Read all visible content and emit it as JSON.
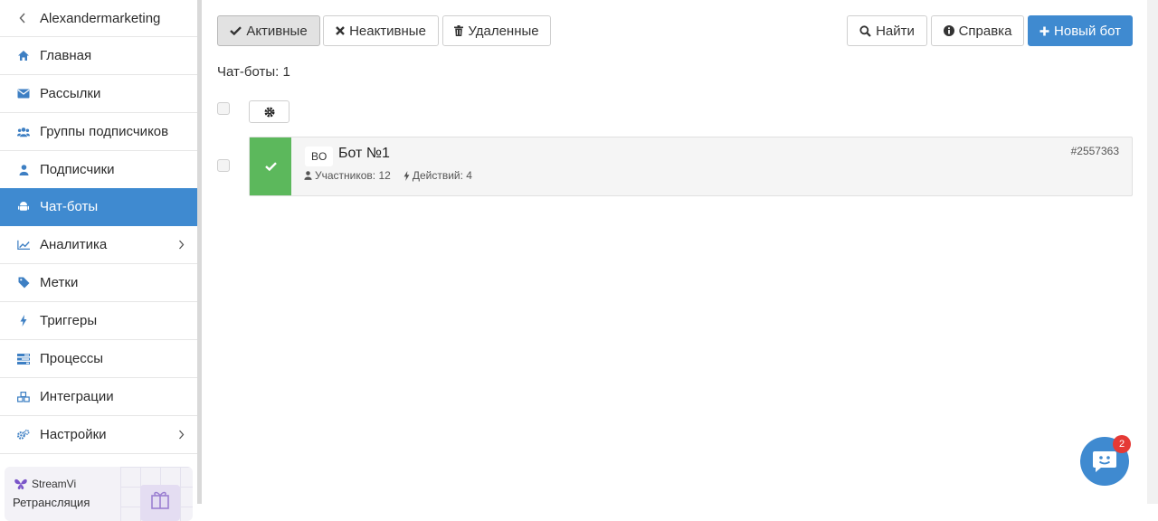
{
  "sidebar": {
    "account_name": "Alexandermarketing",
    "items": [
      {
        "label": "Главная",
        "icon": "home-icon"
      },
      {
        "label": "Рассылки",
        "icon": "envelope-icon"
      },
      {
        "label": "Группы подписчиков",
        "icon": "users-icon"
      },
      {
        "label": "Подписчики",
        "icon": "user-icon"
      },
      {
        "label": "Чат-боты",
        "icon": "android-icon",
        "active": true
      },
      {
        "label": "Аналитика",
        "icon": "chart-line-icon",
        "has_submenu": true
      },
      {
        "label": "Метки",
        "icon": "tag-icon"
      },
      {
        "label": "Триггеры",
        "icon": "bolt-icon"
      },
      {
        "label": "Процессы",
        "icon": "tasks-icon"
      },
      {
        "label": "Интеграции",
        "icon": "cubes-icon"
      },
      {
        "label": "Настройки",
        "icon": "cogs-icon",
        "has_submenu": true
      }
    ],
    "promo": {
      "brand": "StreamVi",
      "subtitle": "Ретрансляция"
    }
  },
  "toolbar": {
    "filter_active": "Активные",
    "filter_inactive": "Неактивные",
    "filter_deleted": "Удаленные",
    "search": "Найти",
    "help": "Справка",
    "new_bot": "Новый бот"
  },
  "bots_count": "Чат-боты: 1",
  "bots": [
    {
      "badge": "BO",
      "name": "Бот №1",
      "id": "#2557363",
      "participants": "Участников: 12",
      "actions": "Действий: 4",
      "status": "active"
    }
  ],
  "chat_widget": {
    "unread": "2"
  },
  "colors": {
    "accent": "#3f8ad0",
    "active_status": "#5cb85c",
    "badge": "#e53935"
  }
}
